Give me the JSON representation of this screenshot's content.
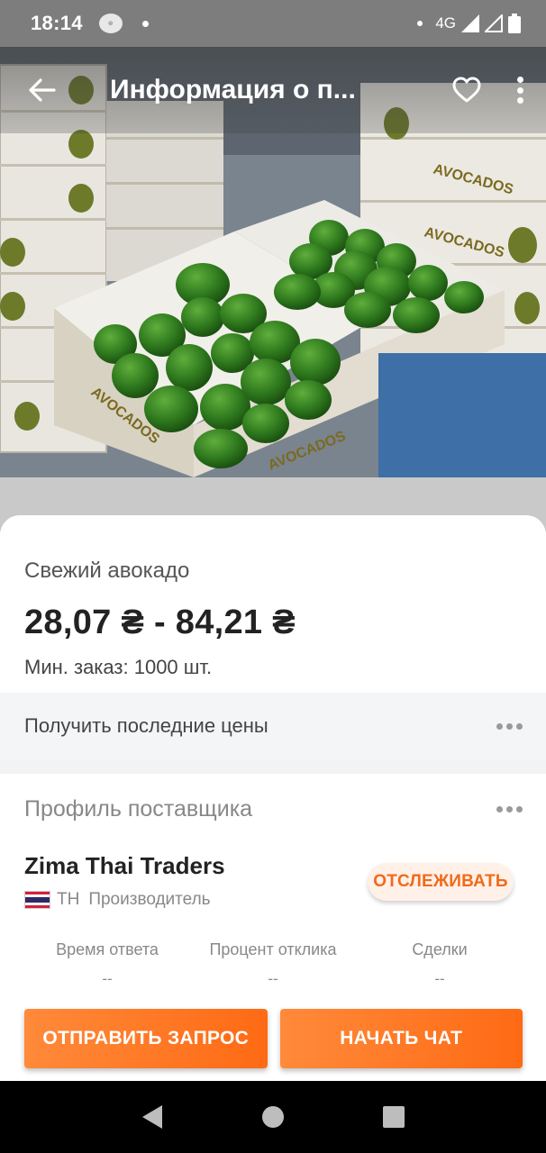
{
  "status_bar": {
    "time": "18:14",
    "network": "4G"
  },
  "header": {
    "title": "Информация о п...",
    "back_icon": "arrow-left-icon",
    "favorite_icon": "heart-icon",
    "menu_icon": "more-vertical-icon"
  },
  "hero": {
    "box_label": "AVOCADOS"
  },
  "product": {
    "name": "Свежий авокадо",
    "price": "28,07 ₴ - 84,21 ₴",
    "min_order": "Мин. заказ: 1000 шт."
  },
  "latest_prices": {
    "label": "Получить последние цены"
  },
  "supplier": {
    "section_label": "Профиль поставщика",
    "name": "Zima Thai Traders",
    "country_code": "TH",
    "type": "Производитель",
    "follow_label": "ОТСЛЕЖИВАТЬ",
    "stats": [
      {
        "label": "Время ответа",
        "value": "--"
      },
      {
        "label": "Процент отклика",
        "value": "--"
      },
      {
        "label": "Сделки",
        "value": "--"
      }
    ]
  },
  "actions": {
    "send_request": "ОТПРАВИТЬ ЗАПРОС",
    "start_chat": "НАЧАТЬ ЧАТ"
  },
  "colors": {
    "accent": "#ff6a14",
    "follow_bg": "#fff1e8"
  }
}
